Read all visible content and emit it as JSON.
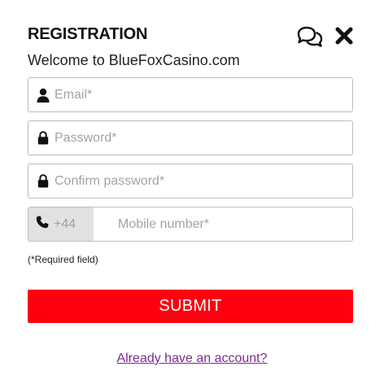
{
  "header": {
    "title": "REGISTRATION",
    "welcome": "Welcome to BlueFoxCasino.com",
    "chat_icon": "chat-bubbles-icon",
    "close_icon": "close-icon"
  },
  "form": {
    "email": {
      "placeholder": "Email*",
      "icon": "user-icon"
    },
    "password": {
      "placeholder": "Password*",
      "icon": "lock-icon"
    },
    "confirm_password": {
      "placeholder": "Confirm password*",
      "icon": "lock-icon"
    },
    "phone": {
      "country_code": "+44",
      "placeholder": "Mobile number*",
      "icon": "phone-icon"
    },
    "required_note": "(*Required field)",
    "submit_label": "SUBMIT"
  },
  "footer": {
    "login_link": "Already have an account?"
  },
  "colors": {
    "submit_bg": "#ff0011",
    "link": "#7b2a90",
    "prefix_bg": "#e2e2e2"
  }
}
